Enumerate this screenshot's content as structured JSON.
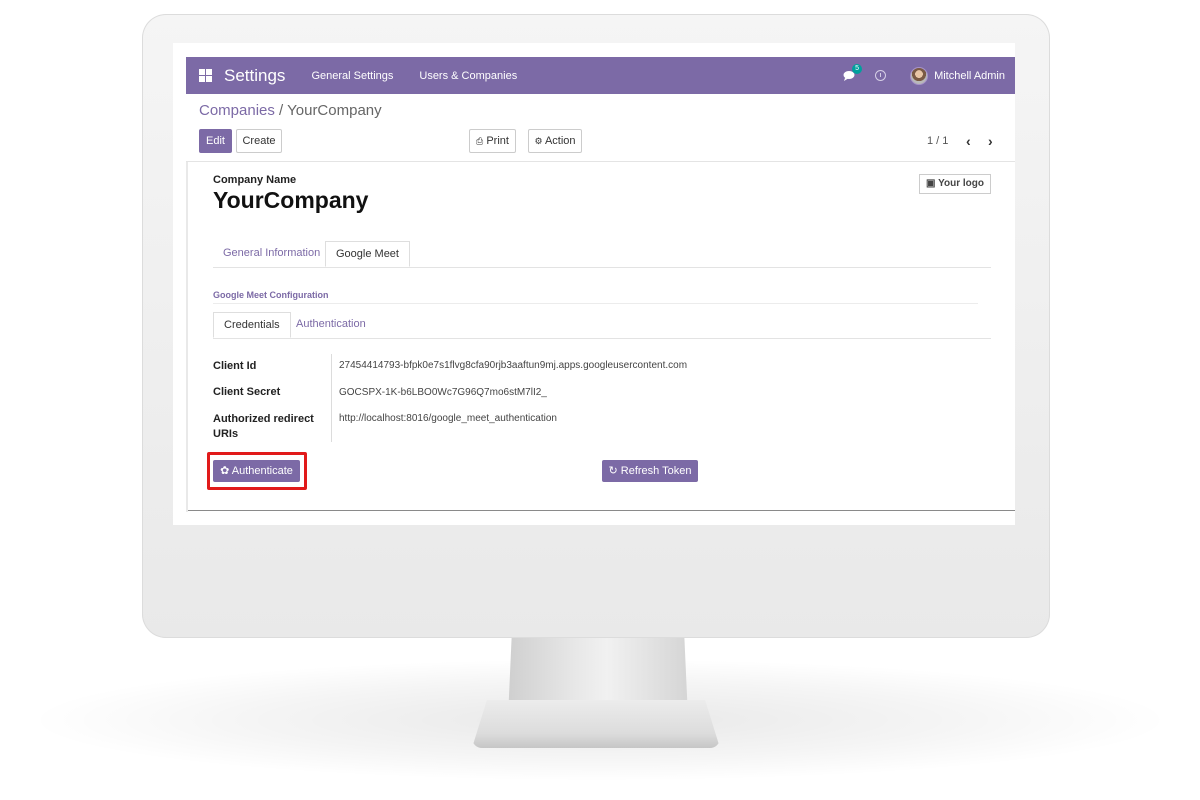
{
  "navbar": {
    "app_title": "Settings",
    "links": [
      "General Settings",
      "Users & Companies"
    ],
    "chat_badge": "5",
    "user_name": "Mitchell Admin"
  },
  "breadcrumb": {
    "parent": "Companies",
    "separator": "/",
    "current": "YourCompany"
  },
  "toolbar": {
    "edit_label": "Edit",
    "create_label": "Create",
    "print_label": "Print",
    "action_label": "Action",
    "pager": "1 / 1"
  },
  "form": {
    "company_name_label": "Company Name",
    "company_name": "YourCompany",
    "logo_label": "Your logo",
    "tabs": [
      {
        "label": "General Information",
        "active": false
      },
      {
        "label": "Google Meet",
        "active": true
      }
    ],
    "section_title": "Google Meet Configuration",
    "subtabs": [
      {
        "label": "Credentials",
        "active": true
      },
      {
        "label": "Authentication",
        "active": false
      }
    ],
    "fields": {
      "client_id_label": "Client Id",
      "client_id": "27454414793-bfpk0e7s1flvg8cfa90rjb3aaftun9mj.apps.googleusercontent.com",
      "client_secret_label": "Client Secret",
      "client_secret": "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",
      "redirect_label_line1": "Authorized redirect",
      "redirect_label_line2": "URIs",
      "redirect_uri": "http://localhost:8016/google_meet_authentication"
    },
    "buttons": {
      "authenticate_label": "Authenticate",
      "refresh_label": "Refresh Token"
    }
  },
  "colors": {
    "brand": "#7c6aa6",
    "highlight": "#e11a1a",
    "badge": "#00a09d"
  }
}
